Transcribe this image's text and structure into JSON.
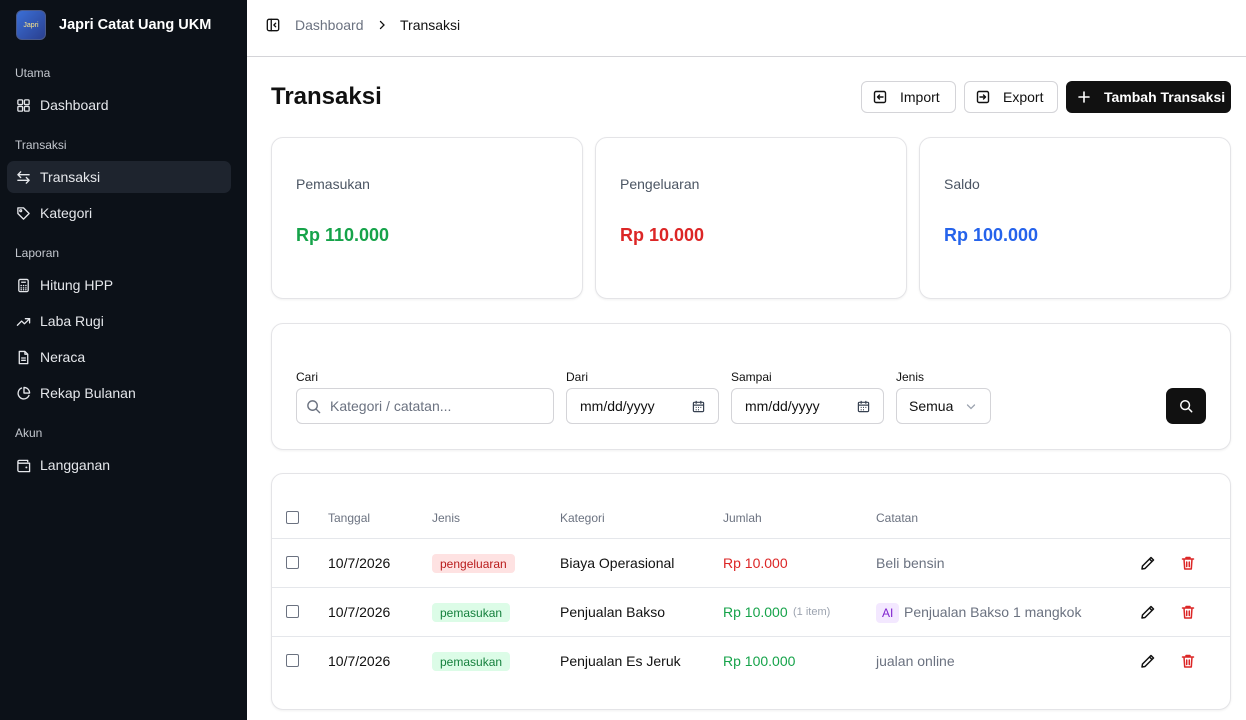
{
  "app": {
    "name": "Japri Catat Uang UKM",
    "logo_text": "Japri"
  },
  "colors": {
    "sidebar_bg": "#0c1118",
    "income": "#16a34a",
    "expense": "#dc2626",
    "balance": "#2563eb"
  },
  "sidebar": {
    "sections": [
      {
        "label": "Utama"
      },
      {
        "label": "Transaksi"
      },
      {
        "label": "Laporan"
      },
      {
        "label": "Akun"
      }
    ],
    "items": [
      {
        "label": "Dashboard",
        "icon": "grid-icon"
      },
      {
        "label": "Transaksi",
        "icon": "swap-icon",
        "active": true
      },
      {
        "label": "Kategori",
        "icon": "tag-icon"
      },
      {
        "label": "Hitung HPP",
        "icon": "calculator-icon"
      },
      {
        "label": "Laba Rugi",
        "icon": "trending-up-icon"
      },
      {
        "label": "Neraca",
        "icon": "file-icon"
      },
      {
        "label": "Rekap Bulanan",
        "icon": "pie-chart-icon"
      },
      {
        "label": "Langganan",
        "icon": "wallet-icon"
      }
    ]
  },
  "breadcrumb": {
    "parent": "Dashboard",
    "current": "Transaksi"
  },
  "page": {
    "title": "Transaksi"
  },
  "actions": {
    "import": "Import",
    "export": "Export",
    "add": "Tambah Transaksi"
  },
  "stats": [
    {
      "label": "Pemasukan",
      "value": "Rp 110.000"
    },
    {
      "label": "Pengeluaran",
      "value": "Rp 10.000"
    },
    {
      "label": "Saldo",
      "value": "Rp 100.000"
    }
  ],
  "filters": {
    "search_label": "Cari",
    "search_placeholder": "Kategori / catatan...",
    "from_label": "Dari",
    "from_value": "mm/dd/yyyy",
    "to_label": "Sampai",
    "to_value": "mm/dd/yyyy",
    "type_label": "Jenis",
    "type_value": "Semua"
  },
  "table": {
    "headers": [
      "Tanggal",
      "Jenis",
      "Kategori",
      "Jumlah",
      "Catatan"
    ],
    "rows": [
      {
        "date": "10/7/2026",
        "type": "pengeluaran",
        "category": "Biaya Operasional",
        "amount": "Rp 10.000",
        "extra": "",
        "ai": "",
        "note": "Beli bensin"
      },
      {
        "date": "10/7/2026",
        "type": "pemasukan",
        "category": "Penjualan Bakso",
        "amount": "Rp 10.000",
        "extra": "(1 item)",
        "ai": "AI",
        "note": "Penjualan Bakso 1 mangkok"
      },
      {
        "date": "10/7/2026",
        "type": "pemasukan",
        "category": "Penjualan Es Jeruk",
        "amount": "Rp 100.000",
        "extra": "",
        "ai": "",
        "note": "jualan online"
      }
    ]
  }
}
